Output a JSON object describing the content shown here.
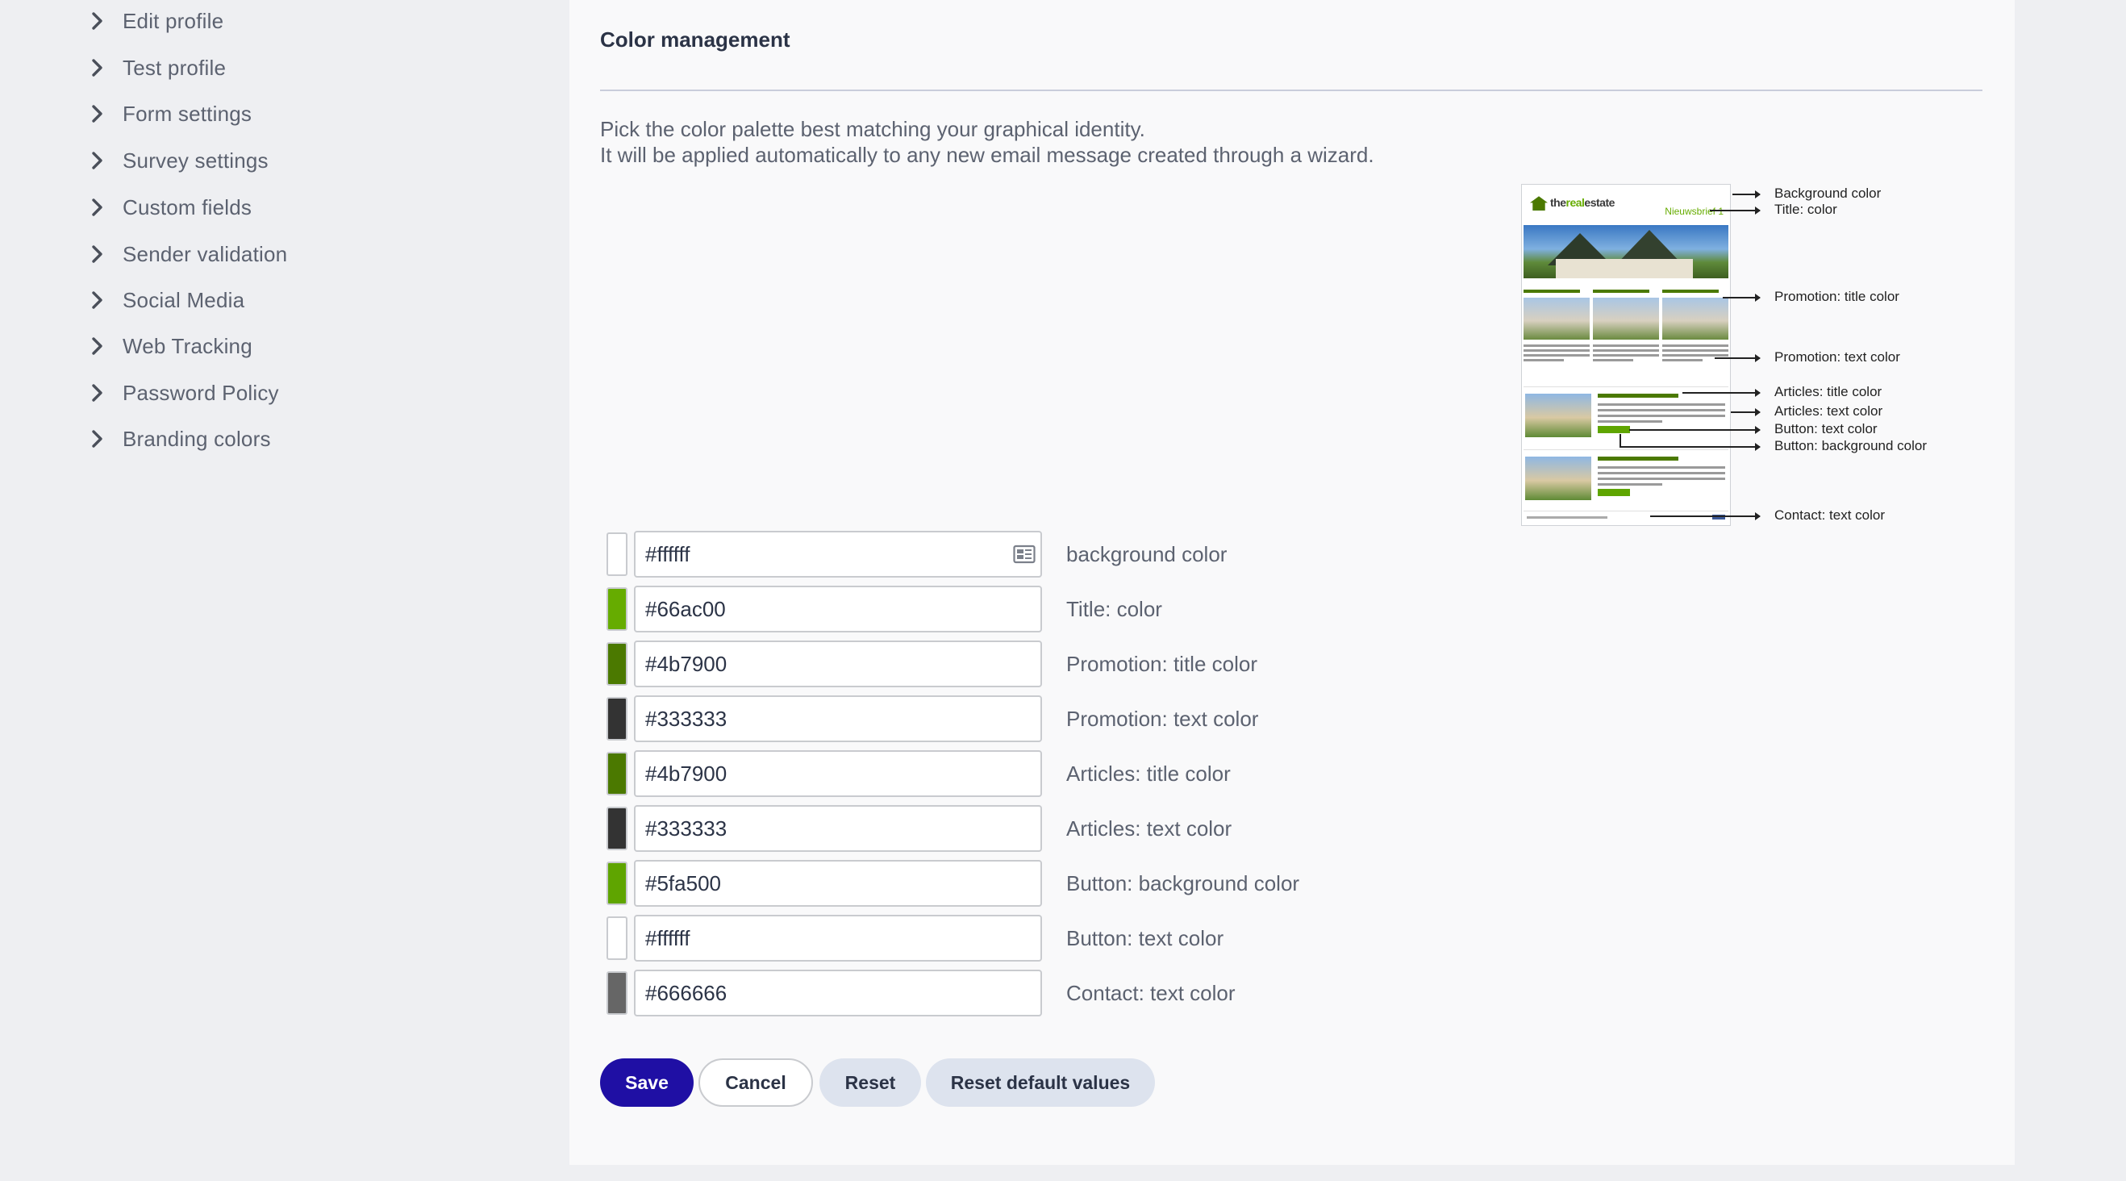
{
  "sidebar": {
    "items": [
      {
        "label": "Edit profile"
      },
      {
        "label": "Test profile"
      },
      {
        "label": "Form settings"
      },
      {
        "label": "Survey settings"
      },
      {
        "label": "Custom fields"
      },
      {
        "label": "Sender validation"
      },
      {
        "label": "Social Media"
      },
      {
        "label": "Web Tracking"
      },
      {
        "label": "Password Policy"
      },
      {
        "label": "Branding colors"
      }
    ]
  },
  "main": {
    "title": "Color management",
    "intro_line1": "Pick the color palette best matching your graphical identity.",
    "intro_line2": "It will be applied automatically to any new email message created through a wizard."
  },
  "preview": {
    "logo_prefix": "the",
    "logo_mid": "real",
    "logo_suffix": "estate",
    "newsletter": "Nieuwsbrief 1",
    "annotations": [
      "Background color",
      "Title: color",
      "Promotion: title color",
      "Promotion: text color",
      "Articles: title color",
      "Articles: text color",
      "Button: text color",
      "Button: background color",
      "Contact: text color"
    ]
  },
  "colors": [
    {
      "value": "#ffffff",
      "label": "background color"
    },
    {
      "value": "#66ac00",
      "label": "Title: color"
    },
    {
      "value": "#4b7900",
      "label": "Promotion: title color"
    },
    {
      "value": "#333333",
      "label": "Promotion: text color"
    },
    {
      "value": "#4b7900",
      "label": "Articles: title color"
    },
    {
      "value": "#333333",
      "label": "Articles: text color"
    },
    {
      "value": "#5fa500",
      "label": "Button: background color"
    },
    {
      "value": "#ffffff",
      "label": "Button: text color"
    },
    {
      "value": "#666666",
      "label": "Contact: text color"
    }
  ],
  "buttons": {
    "save": "Save",
    "cancel": "Cancel",
    "reset": "Reset",
    "reset_default": "Reset default values"
  },
  "theme": {
    "primary": "#1f0fa4",
    "secondary_button_bg": "#dde3ee"
  }
}
